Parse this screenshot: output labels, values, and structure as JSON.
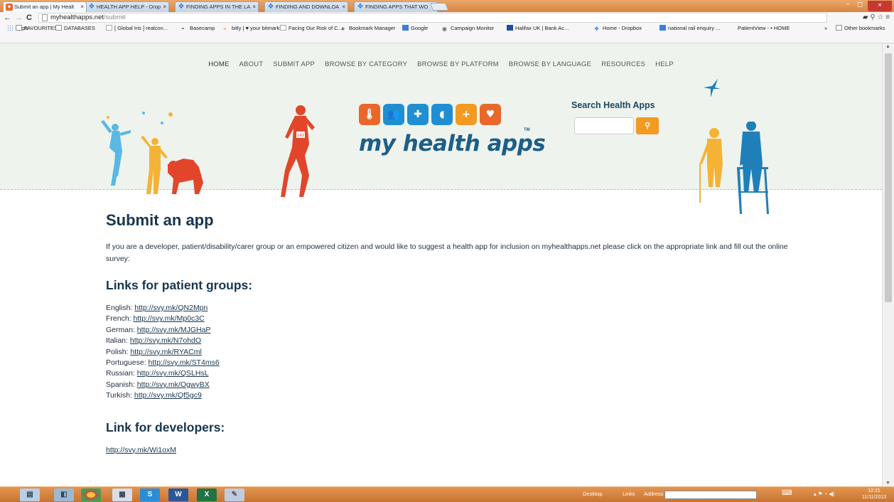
{
  "browser": {
    "tabs": [
      {
        "label": "Submit an app | My Healt",
        "active": true,
        "icon": "mha-favicon"
      },
      {
        "label": "HEALTH APP HELP - Drop",
        "active": false,
        "icon": "dropbox-favicon"
      },
      {
        "label": "FINDING APPS IN THE LA",
        "active": false,
        "icon": "dropbox-favicon"
      },
      {
        "label": "FINDING AND DOWNLOA",
        "active": false,
        "icon": "dropbox-favicon"
      },
      {
        "label": "FINDING APPS THAT WO",
        "active": false,
        "icon": "dropbox-favicon"
      }
    ],
    "close_glyph": "×",
    "address": {
      "host": "myhealthapps.net",
      "path": "/submit"
    },
    "bookmarks": [
      {
        "label": "Apps",
        "icon": "apps-grid-icon"
      },
      {
        "label": "FAVOURITES",
        "icon": "folder-icon"
      },
      {
        "label": "DATABASES",
        "icon": "folder-icon"
      },
      {
        "label": "[ Global Iris ] realcon...",
        "icon": "page-icon"
      },
      {
        "label": "Basecamp",
        "icon": "basecamp-icon"
      },
      {
        "label": "bitly | ♥ your bitmarks",
        "icon": "bitly-icon"
      },
      {
        "label": "Facing Our Risk of C...",
        "icon": "page-icon"
      },
      {
        "label": "Bookmark Manager",
        "icon": "star-icon"
      },
      {
        "label": "Google",
        "icon": "google-icon"
      },
      {
        "label": "Campaign Monitor",
        "icon": "campaign-icon"
      },
      {
        "label": "Halifax UK | Bank Ac...",
        "icon": "halifax-icon"
      },
      {
        "label": "Home - Dropbox",
        "icon": "dropbox-icon"
      },
      {
        "label": "national rail enquiry ...",
        "icon": "google-icon"
      },
      {
        "label": "PatientView - • HOME",
        "icon": "none"
      },
      {
        "label": "Other bookmarks",
        "icon": "folder-icon"
      }
    ],
    "overflow": "»"
  },
  "site": {
    "nav": [
      "HOME",
      "ABOUT",
      "SUBMIT APP",
      "BROWSE BY CATEGORY",
      "BROWSE BY PLATFORM",
      "BROWSE BY LANGUAGE",
      "RESOURCES",
      "HELP"
    ],
    "brand": "my health apps",
    "tm": "TM",
    "search_label": "Search Health Apps",
    "search_value": "",
    "search_button_icon": "search-icon",
    "tile_colors": [
      "#e9672a",
      "#1f8fd1",
      "#1f8fd1",
      "#1f8fd1",
      "#f39a22",
      "#e9672a"
    ],
    "runner_bib": "143"
  },
  "content": {
    "title": "Submit an app",
    "intro": "If you are a developer, patient/disability/carer group or an empowered citizen and would like to suggest a health app for inclusion on myhealthapps.net please click on the appropriate link and fill out the online survey:",
    "patient_heading": "Links for patient groups:",
    "patient_links": [
      {
        "lang": "English: ",
        "url": "http://svy.mk/QN2Mpn"
      },
      {
        "lang": "French: ",
        "url": "http://svy.mk/Mp0c3C"
      },
      {
        "lang": "German: ",
        "url": "http://svy.mk/MJGHaP"
      },
      {
        "lang": "Italian: ",
        "url": "http://svy.mk/N7ohdO"
      },
      {
        "lang": "Polish: ",
        "url": "http://svy.mk/RYACml"
      },
      {
        "lang": "Portuguese: ",
        "url": "http://svy.mk/ST4ms6"
      },
      {
        "lang": "Russian: ",
        "url": "http://svy.mk/QSLHsL"
      },
      {
        "lang": "Spanish: ",
        "url": "http://svy.mk/OgwyBX"
      },
      {
        "lang": "Turkish: ",
        "url": "http://svy.mk/Qf5gc9"
      }
    ],
    "dev_heading": "Link for developers:",
    "dev_link": "http://svy.mk/Wi1oxM"
  },
  "taskbar": {
    "desktop_label": "Desktop",
    "links_label": "Links",
    "address_label": "Address",
    "time": "12:21",
    "date": "11/11/2013"
  }
}
